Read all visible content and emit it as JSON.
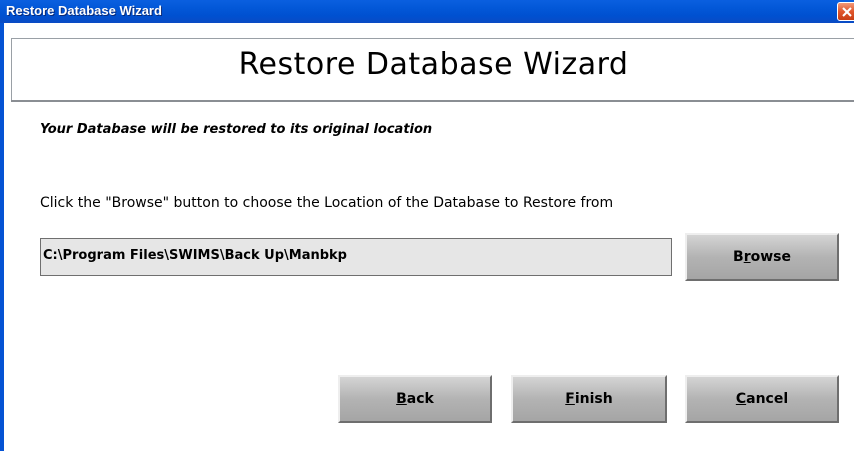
{
  "window": {
    "title": "Restore Database Wizard"
  },
  "header": {
    "title": "Restore Database Wizard"
  },
  "content": {
    "info_text": "Your Database will be restored to its original location",
    "instruction": "Click the \"Browse\"  button to choose the Location of the Database to Restore from",
    "path_value": "C:\\Program Files\\SWIMS\\Back Up\\Manbkp"
  },
  "buttons": {
    "browse": {
      "mnemonic_before": "B",
      "mnemonic": "r",
      "after": "owse"
    },
    "back": {
      "mnemonic_before": "",
      "mnemonic": "B",
      "after": "ack"
    },
    "finish": {
      "mnemonic_before": "",
      "mnemonic": "F",
      "after": "inish"
    },
    "cancel": {
      "mnemonic_before": "",
      "mnemonic": "C",
      "after": "ancel"
    }
  },
  "icons": {
    "close": "close-icon"
  },
  "colors": {
    "titlebar": "#0358d8",
    "close_button": "#e0562c",
    "button_face": "#b3b3b3",
    "input_background": "#e6e6e6"
  }
}
